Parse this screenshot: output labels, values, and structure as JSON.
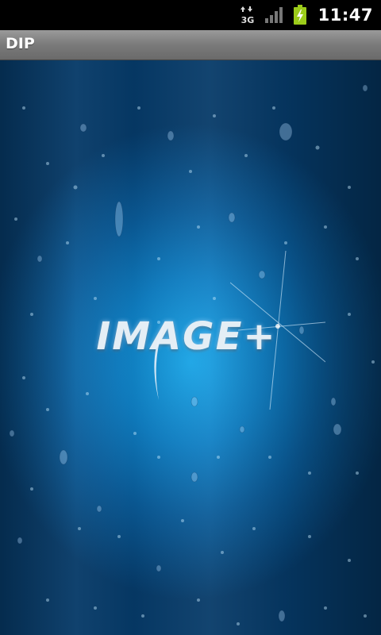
{
  "status_bar": {
    "network_icon": "3g-data-icon",
    "network_label": "3G",
    "signal_icon": "signal-strength-icon",
    "battery_icon": "battery-charging-icon",
    "time": "11:47"
  },
  "title_bar": {
    "title": "DIP"
  },
  "splash": {
    "logo_text": "IMAGE+",
    "background_colors": [
      "#063a68",
      "#0f7fc4",
      "#1aa6e8"
    ]
  }
}
